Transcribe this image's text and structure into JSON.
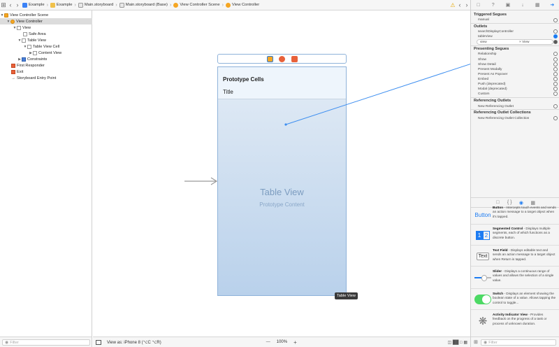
{
  "jumpbar": {
    "crumbs": [
      "Example",
      "Example",
      "Main.storyboard",
      "Main.storyboard (Base)",
      "View Controller Scene",
      "View Controller"
    ]
  },
  "outline": {
    "items": [
      {
        "label": "View Controller Scene"
      },
      {
        "label": "View Controller"
      },
      {
        "label": "View"
      },
      {
        "label": "Safe Area"
      },
      {
        "label": "Table View"
      },
      {
        "label": "Table View Cell"
      },
      {
        "label": "Content View"
      },
      {
        "label": "Constraints"
      },
      {
        "label": "First Responder"
      },
      {
        "label": "Exit"
      },
      {
        "label": "Storyboard Entry Point"
      }
    ],
    "filter_placeholder": "Filter"
  },
  "canvas": {
    "proto_cells": "Prototype Cells",
    "cell_title": "Title",
    "table_view": "Table View",
    "proto_content": "Prototype Content",
    "tooltip": "Table View"
  },
  "bottombar": {
    "view_as": "View as: iPhone 8 (⌥C ⌥R)",
    "zoom": "100%",
    "minus": "—",
    "plus": "+"
  },
  "inspector": {
    "triggered_segues": "Triggered Segues",
    "manual": "manual",
    "outlets": "Outlets",
    "outlet_items": [
      "searchDisplayController",
      "tableView",
      "view"
    ],
    "view_target": "View",
    "presenting_segues": "Presenting Segues",
    "segue_items": [
      "Relationship",
      "Show",
      "Show Detail",
      "Present Modally",
      "Present As Popover",
      "Embed",
      "Push (deprecated)",
      "Modal (deprecated)",
      "Custom"
    ],
    "referencing_outlets": "Referencing Outlets",
    "new_ref_outlet": "New Referencing Outlet",
    "referencing_collections": "Referencing Outlet Collections",
    "new_ref_collection": "New Referencing Outlet Collection"
  },
  "library": {
    "items": [
      {
        "icon_text": "Button",
        "name": "Button",
        "desc": " - Intercepts touch events and sends an action message to a target object when it's tapped."
      },
      {
        "icon_text": "",
        "name": "Segmented Control",
        "desc": " - Displays multiple segments, each of which functions as a discrete button."
      },
      {
        "icon_text": "Text",
        "name": "Text Field",
        "desc": " - Displays editable text and sends an action message to a target object when Return is tapped."
      },
      {
        "icon_text": "",
        "name": "Slider",
        "desc": " - Displays a continuous range of values and allows the selection of a single value."
      },
      {
        "icon_text": "",
        "name": "Switch",
        "desc": " - Displays an element showing the boolean state of a value. Allows tapping the control to toggle..."
      },
      {
        "icon_text": "",
        "name": "Activity Indicator View",
        "desc": " - Provides feedback on the progress of a task or process of unknown duration."
      }
    ],
    "segment_labels": [
      "1",
      "2"
    ],
    "filter_placeholder": "Filter"
  },
  "colors": {
    "accent": "#1d7cf2",
    "selection": "#dcdcdc",
    "scene_yellow": "#f5a623",
    "orange": "#e8613a",
    "table_blue": "#b9d1eb"
  }
}
